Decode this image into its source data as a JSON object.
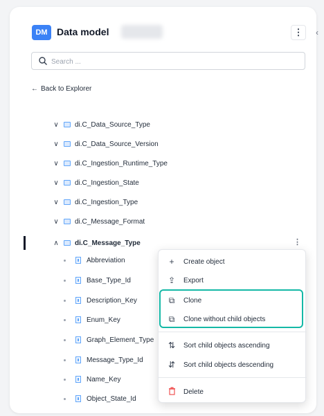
{
  "header": {
    "badge": "DM",
    "title": "Data model",
    "kebab_icon": "⋮",
    "collapse_icon": "‹"
  },
  "search": {
    "placeholder": "Search ..."
  },
  "back_link": {
    "label": "Back to Explorer",
    "arrow": "←"
  },
  "tree": {
    "items": [
      {
        "label": "di.C_Data_Source_Type",
        "expanded": false
      },
      {
        "label": "di.C_Data_Source_Version",
        "expanded": false
      },
      {
        "label": "di.C_Ingestion_Runtime_Type",
        "expanded": false
      },
      {
        "label": "di.C_Ingestion_State",
        "expanded": false
      },
      {
        "label": "di.C_Ingestion_Type",
        "expanded": false
      },
      {
        "label": "di.C_Message_Format",
        "expanded": false
      },
      {
        "label": "di.C_Message_Type",
        "expanded": true,
        "selected": true
      }
    ],
    "chevron_collapsed": "∨",
    "chevron_expanded": "∧",
    "children": [
      "Abbreviation",
      "Base_Type_Id",
      "Description_Key",
      "Enum_Key",
      "Graph_Element_Type",
      "Message_Type_Id",
      "Name_Key",
      "Object_State_Id"
    ]
  },
  "context_menu": {
    "items": [
      {
        "label": "Create object",
        "icon": "plus-icon",
        "glyph": "+"
      },
      {
        "label": "Export",
        "icon": "export-icon",
        "glyph": "⇪"
      },
      {
        "label": "Clone",
        "icon": "clone-icon",
        "glyph": "⧉"
      },
      {
        "label": "Clone without child objects",
        "icon": "clone-icon",
        "glyph": "⧉"
      },
      {
        "label": "Sort child objects ascending",
        "icon": "sort-ascending-icon",
        "glyph": "⇅"
      },
      {
        "label": "Sort child objects descending",
        "icon": "sort-descending-icon",
        "glyph": "⇵"
      },
      {
        "label": "Delete",
        "icon": "trash-icon",
        "glyph": "🗑"
      }
    ]
  },
  "colors": {
    "accent": "#3b82f6",
    "highlight": "#14b8a6",
    "danger": "#ef4444"
  }
}
